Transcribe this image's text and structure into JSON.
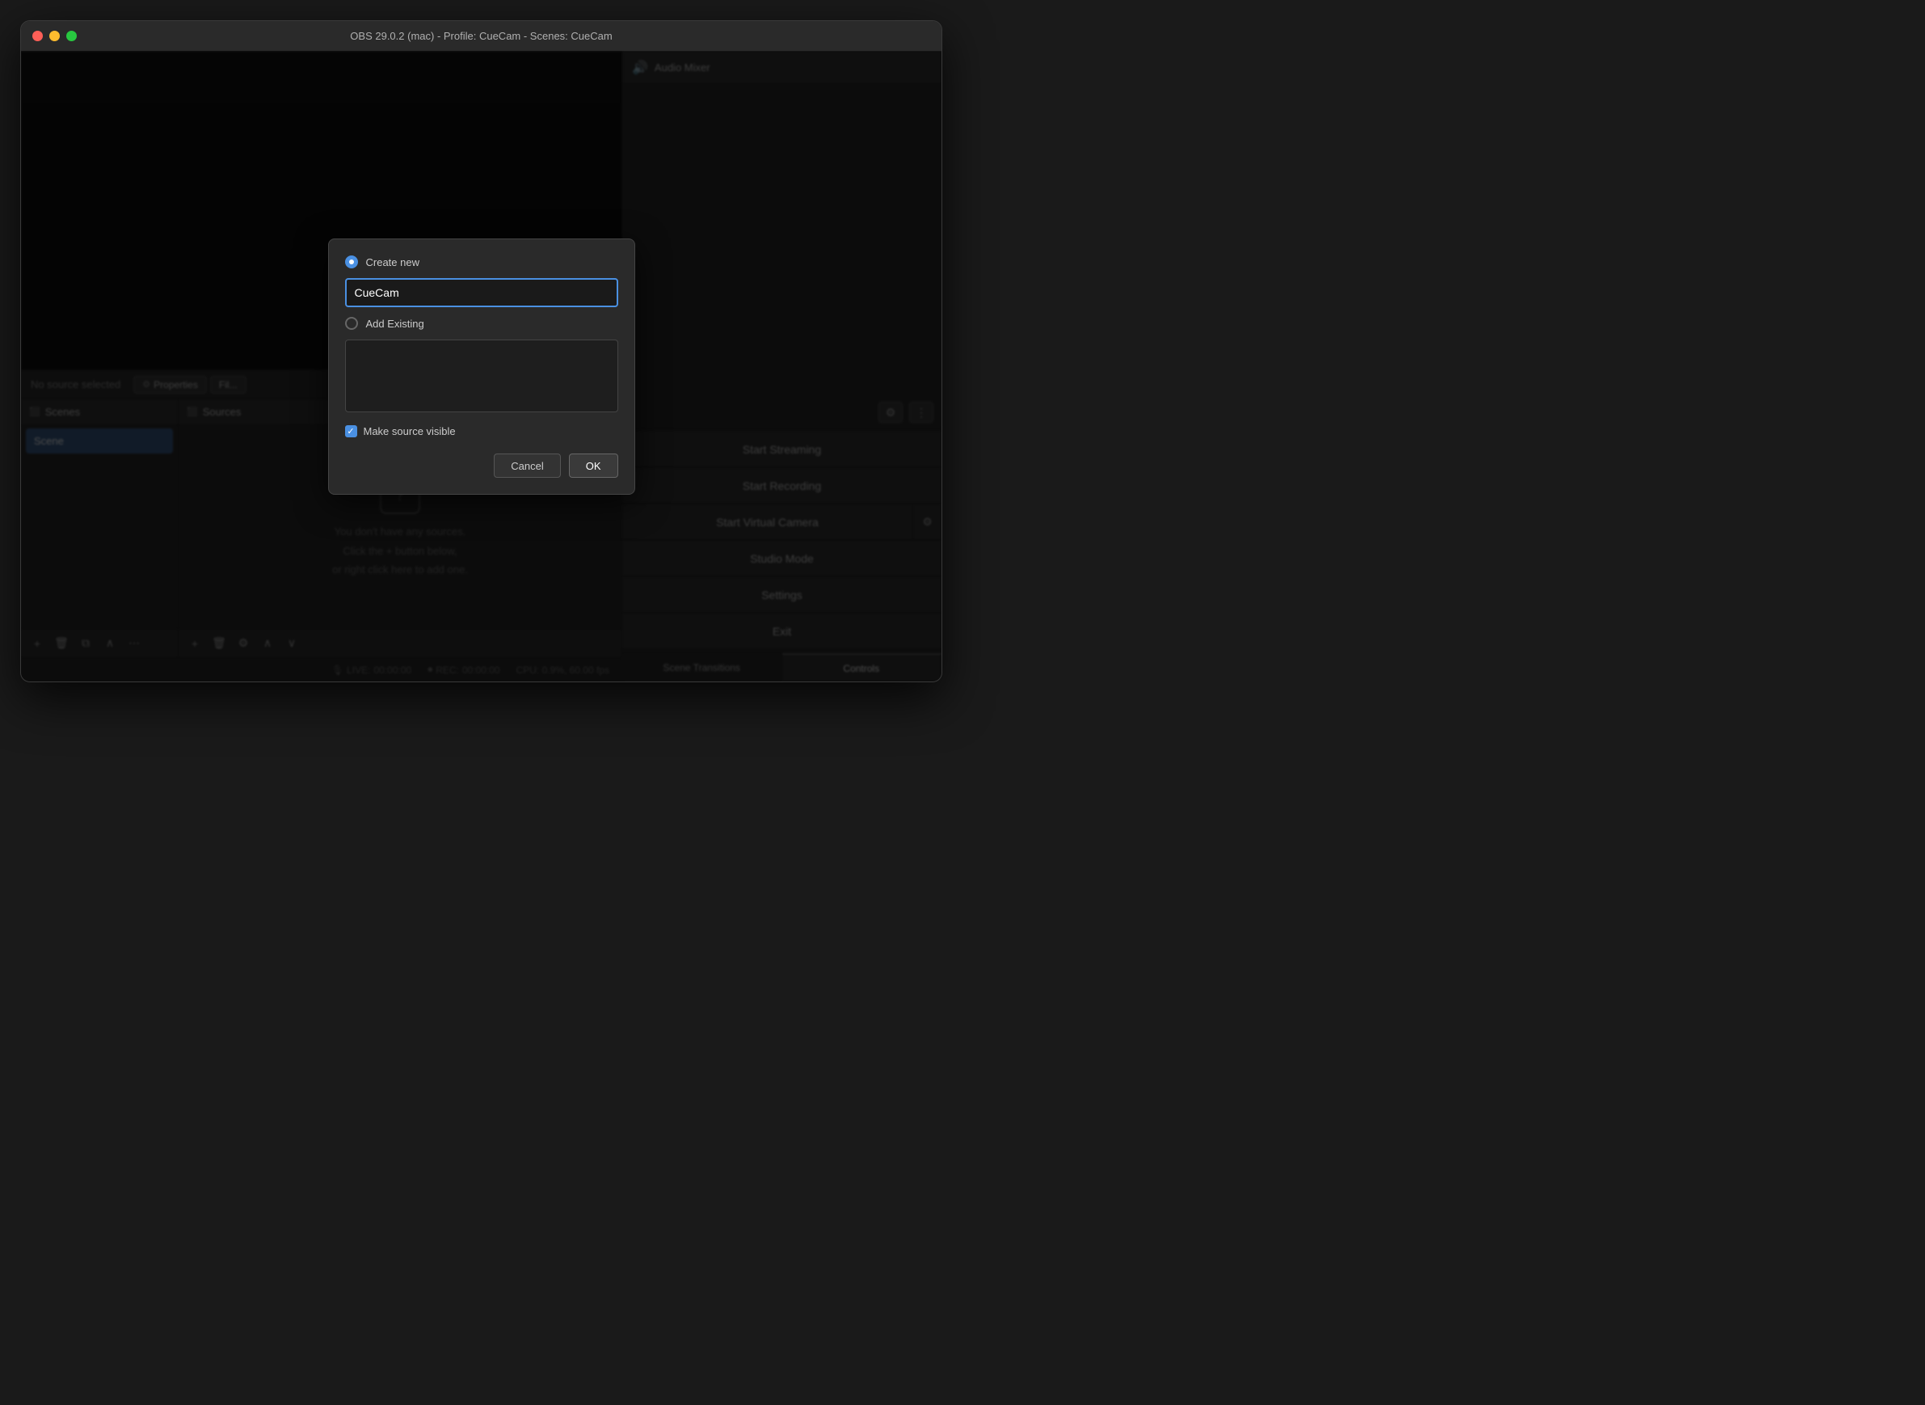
{
  "window": {
    "title": "OBS 29.0.2 (mac) - Profile: CueCam - Scenes: CueCam"
  },
  "titlebar": {
    "buttons": {
      "close": "×",
      "minimize": "−",
      "maximize": "+"
    }
  },
  "audio_mixer": {
    "label": "Audio Mixer",
    "icon": "🔊"
  },
  "source_status": {
    "text": "No source selected",
    "properties_label": "Properties",
    "filters_label": "Fil..."
  },
  "scenes_panel": {
    "title": "Scenes",
    "icon": "⬛",
    "items": [
      {
        "label": "Scene",
        "active": true
      }
    ]
  },
  "sources_panel": {
    "title": "Sources",
    "icon": "⬛",
    "empty_message": "You don't have any sources.\nClick the + button below,\nor right click here to add one."
  },
  "controls": {
    "title": "Controls",
    "start_streaming": "Start Streaming",
    "start_recording": "Start Recording",
    "start_virtual_camera": "Start Virtual Camera",
    "studio_mode": "Studio Mode",
    "settings": "Settings",
    "exit": "Exit"
  },
  "scene_transitions": {
    "label": "Scene Transitions"
  },
  "controls_tab": {
    "label": "Controls",
    "active": true
  },
  "status_bar": {
    "live_label": "LIVE:",
    "live_time": "00:00:00",
    "rec_label": "REC:",
    "rec_time": "00:00:00",
    "cpu_label": "CPU: 0.9%, 60.00 fps"
  },
  "modal": {
    "create_new_label": "Create new",
    "input_value": "CueCam",
    "add_existing_label": "Add Existing",
    "make_visible_label": "Make source visible",
    "cancel_label": "Cancel",
    "ok_label": "OK"
  },
  "toolbar": {
    "add": "+",
    "remove": "🗑",
    "duplicate": "⧉",
    "up": "∧",
    "more": "⋯",
    "move_up": "∧",
    "move_down": "∨",
    "gear": "⚙",
    "dots": "⋮"
  }
}
